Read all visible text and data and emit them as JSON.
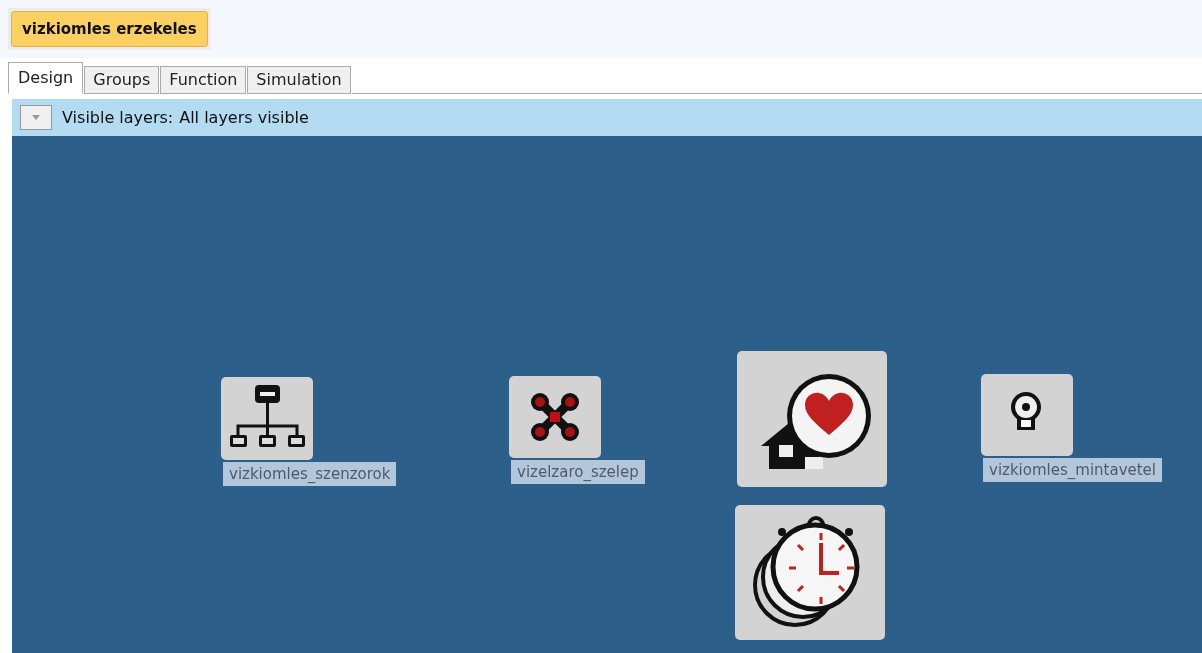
{
  "title_button": "vizkiomles erzekeles",
  "tabs": [
    {
      "label": "Design",
      "selected": true
    },
    {
      "label": "Groups",
      "selected": false
    },
    {
      "label": "Function",
      "selected": false
    },
    {
      "label": "Simulation",
      "selected": false
    }
  ],
  "layers": {
    "label": "Visible layers:",
    "value": "All layers visible"
  },
  "nodes": [
    {
      "kind": "network",
      "label": "vizkiomles_szenzorok"
    },
    {
      "kind": "valve",
      "label": "vizelzaro_szelep"
    },
    {
      "kind": "house"
    },
    {
      "kind": "timer"
    },
    {
      "kind": "sensor",
      "label": "vizkiomles_mintavetel"
    }
  ]
}
